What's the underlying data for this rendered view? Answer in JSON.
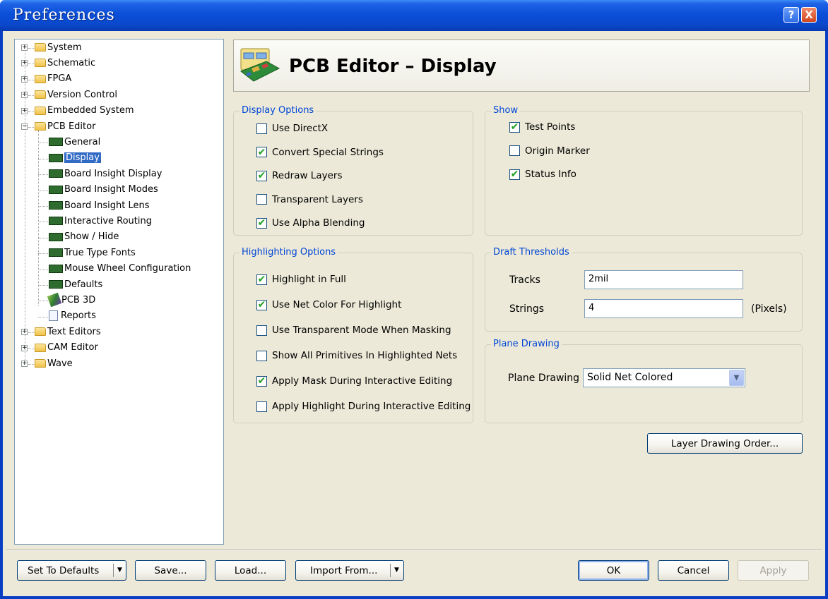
{
  "window": {
    "title": "Preferences"
  },
  "titlebar_buttons": {
    "help": "?",
    "close": "X"
  },
  "tree": {
    "items": [
      {
        "label": "System",
        "icon": "folder-icon",
        "expander": "+"
      },
      {
        "label": "Schematic",
        "icon": "folder-icon",
        "expander": "+"
      },
      {
        "label": "FPGA",
        "icon": "folder-icon",
        "expander": "+"
      },
      {
        "label": "Version Control",
        "icon": "folder-icon",
        "expander": "+"
      },
      {
        "label": "Embedded System",
        "icon": "folder-icon",
        "expander": "+"
      },
      {
        "label": "PCB Editor",
        "icon": "folder-open-icon",
        "expander": "−"
      },
      {
        "label": "General",
        "icon": "pcb-chip-icon"
      },
      {
        "label": "Display",
        "icon": "pcb-chip-icon",
        "selected": true
      },
      {
        "label": "Board Insight Display",
        "icon": "pcb-chip-icon"
      },
      {
        "label": "Board Insight Modes",
        "icon": "pcb-chip-icon"
      },
      {
        "label": "Board Insight Lens",
        "icon": "pcb-chip-icon"
      },
      {
        "label": "Interactive Routing",
        "icon": "pcb-chip-icon"
      },
      {
        "label": "Show / Hide",
        "icon": "pcb-chip-icon"
      },
      {
        "label": "True Type Fonts",
        "icon": "pcb-chip-icon"
      },
      {
        "label": "Mouse Wheel Configuration",
        "icon": "pcb-chip-icon"
      },
      {
        "label": "Defaults",
        "icon": "pcb-chip-icon"
      },
      {
        "label": "PCB 3D",
        "icon": "pcb-3d-icon"
      },
      {
        "label": "Reports",
        "icon": "report-icon"
      },
      {
        "label": "Text Editors",
        "icon": "folder-icon",
        "expander": "+"
      },
      {
        "label": "CAM Editor",
        "icon": "folder-icon",
        "expander": "+"
      },
      {
        "label": "Wave",
        "icon": "folder-icon",
        "expander": "+"
      }
    ]
  },
  "header": {
    "title": "PCB Editor – Display",
    "icon": "pcb-board-icon"
  },
  "display_options": {
    "legend": "Display Options",
    "items": [
      {
        "label": "Use DirectX",
        "checked": false
      },
      {
        "label": "Convert Special Strings",
        "checked": true
      },
      {
        "label": "Redraw Layers",
        "checked": true
      },
      {
        "label": "Transparent Layers",
        "checked": false
      },
      {
        "label": "Use Alpha Blending",
        "checked": true
      }
    ]
  },
  "show": {
    "legend": "Show",
    "items": [
      {
        "label": "Test Points",
        "checked": true
      },
      {
        "label": "Origin Marker",
        "checked": false
      },
      {
        "label": "Status Info",
        "checked": true
      }
    ]
  },
  "highlighting_options": {
    "legend": "Highlighting Options",
    "items": [
      {
        "label": "Highlight in Full",
        "checked": true
      },
      {
        "label": "Use Net Color For Highlight",
        "checked": true
      },
      {
        "label": "Use Transparent Mode When Masking",
        "checked": false
      },
      {
        "label": "Show All Primitives In Highlighted Nets",
        "checked": false
      },
      {
        "label": "Apply Mask During Interactive Editing",
        "checked": true
      },
      {
        "label": "Apply Highlight During Interactive Editing",
        "checked": false
      }
    ]
  },
  "draft_thresholds": {
    "legend": "Draft Thresholds",
    "tracks_label": "Tracks",
    "tracks_value": "2mil",
    "strings_label": "Strings",
    "strings_value": "4",
    "strings_unit": "(Pixels)"
  },
  "plane_drawing": {
    "legend": "Plane Drawing",
    "label": "Plane Drawing",
    "value": "Solid Net Colored"
  },
  "layer_drawing_order_button": "Layer Drawing Order...",
  "bottom_buttons": {
    "set_to_defaults": "Set To Defaults",
    "save": "Save...",
    "load": "Load...",
    "import_from": "Import From...",
    "ok": "OK",
    "cancel": "Cancel",
    "apply": "Apply"
  },
  "check_glyph": "✔",
  "dropdown_glyph": "▼"
}
